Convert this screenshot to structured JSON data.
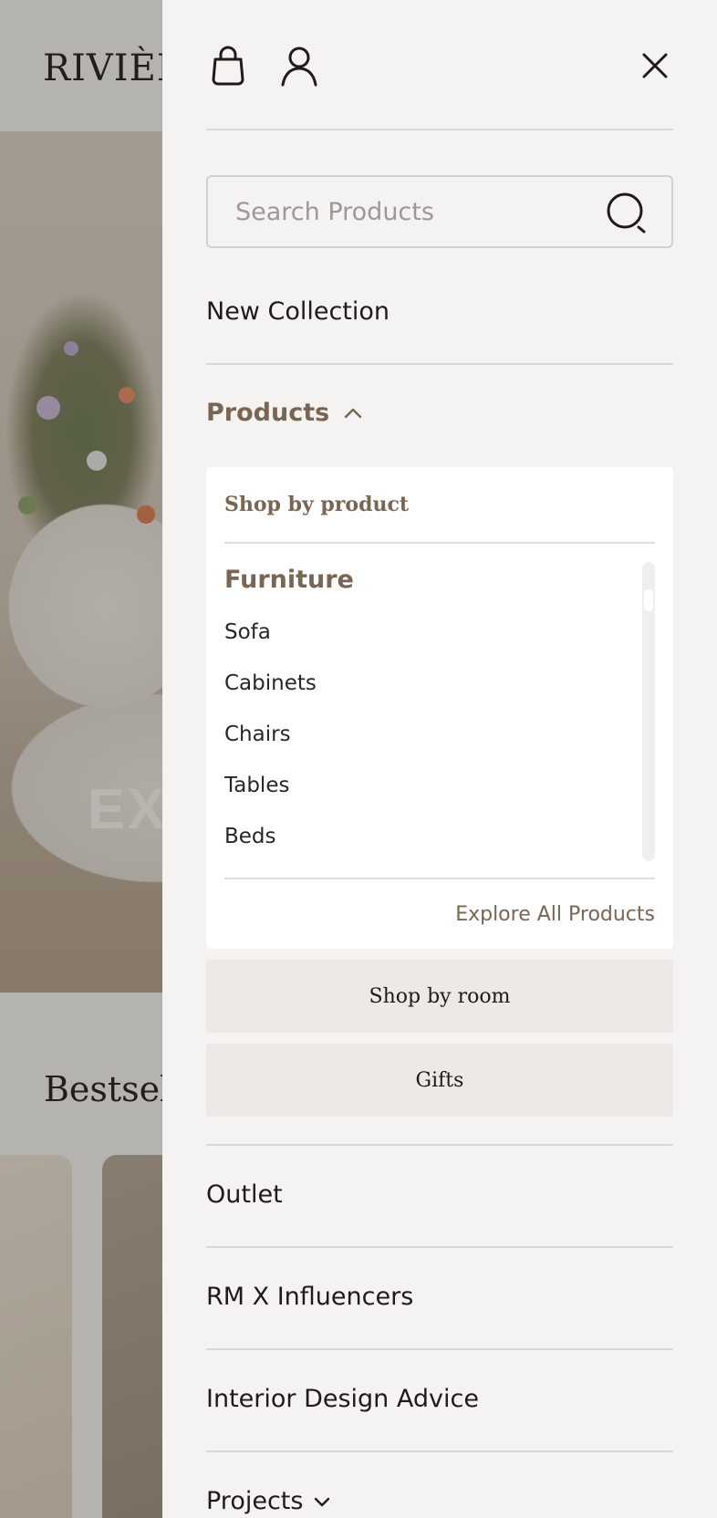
{
  "background": {
    "logo": "RIVIÈRE",
    "hero_text": "EXPLORE",
    "section_title": "Bestsellers"
  },
  "drawer": {
    "icons": {
      "bag": "shopping-bag-icon",
      "account": "user-icon",
      "close": "close-icon",
      "search": "search-icon"
    },
    "search": {
      "placeholder": "Search Products"
    },
    "nav": {
      "new_collection": "New Collection",
      "products": "Products",
      "outlet": "Outlet",
      "influencers": "RM X Influencers",
      "interior_advice": "Interior Design Advice",
      "projects": "Projects"
    },
    "products_panel": {
      "title": "Shop by product",
      "category": "Furniture",
      "items": [
        "Sofa",
        "Cabinets",
        "Chairs",
        "Tables",
        "Beds"
      ],
      "explore_link": "Explore All Products"
    },
    "sub_buttons": {
      "shop_by_room": "Shop by room",
      "gifts": "Gifts"
    },
    "colors": {
      "accent": "#7a6553",
      "drawer_bg": "#f4f3f1",
      "button_bg": "#ece9e6",
      "divider": "#dad8d5"
    }
  }
}
